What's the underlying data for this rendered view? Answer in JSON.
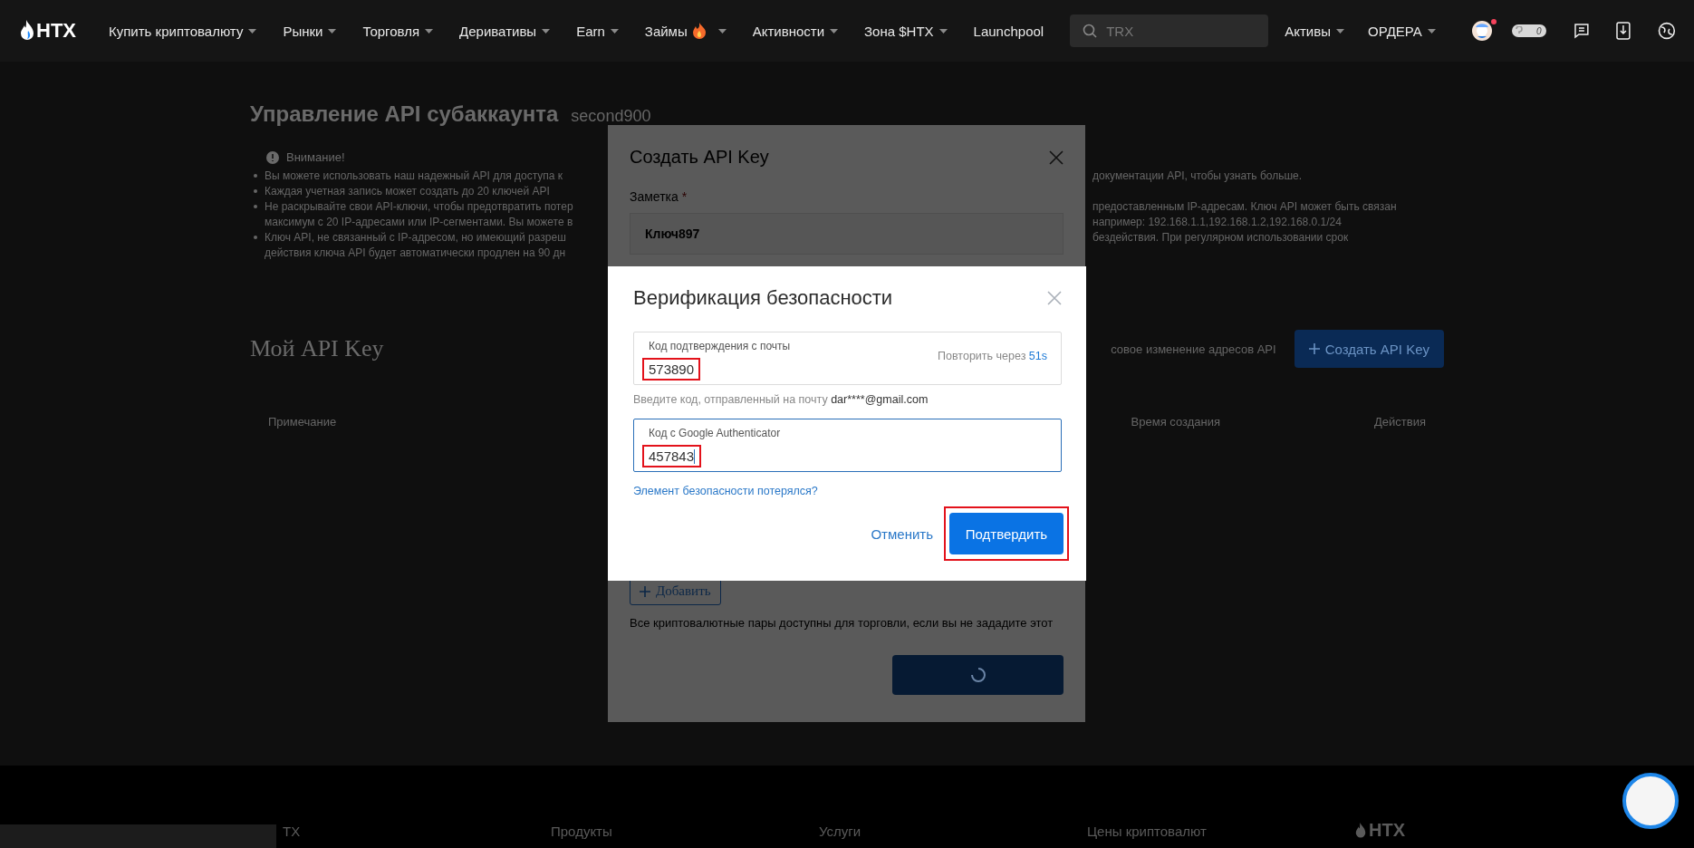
{
  "nav": {
    "logo": "HTX",
    "items": [
      {
        "label": "Купить криптовалюту",
        "dropdown": true,
        "hot": false
      },
      {
        "label": "Рынки",
        "dropdown": true,
        "hot": false
      },
      {
        "label": "Торговля",
        "dropdown": true,
        "hot": false
      },
      {
        "label": "Деривативы",
        "dropdown": true,
        "hot": false
      },
      {
        "label": "Earn",
        "dropdown": true,
        "hot": false
      },
      {
        "label": "Займы",
        "dropdown": true,
        "hot": true
      },
      {
        "label": "Активности",
        "dropdown": true,
        "hot": false
      },
      {
        "label": "Зона $HTX",
        "dropdown": true,
        "hot": false
      },
      {
        "label": "Launchpool",
        "dropdown": false,
        "hot": false
      }
    ],
    "search": {
      "placeholder": "TRX"
    },
    "right_items": [
      {
        "label": "Активы",
        "dropdown": true
      },
      {
        "label": "ОРДЕРА",
        "dropdown": true
      }
    ],
    "avatar_notification": true,
    "pill_text": "0"
  },
  "page": {
    "title": "Управление API субаккаунта",
    "subtitle": "second900",
    "notice_title": "Внимание!",
    "notice_rows": [
      {
        "left": "Вы можете использовать наш надежный API для доступа к",
        "right": "документации API, чтобы узнать больше.",
        "bullet": true
      },
      {
        "left": "Каждая учетная запись может создать до 20 ключей API",
        "bullet": true
      },
      {
        "left": "Не раскрывайте свои API-ключи, чтобы предотвратить потер",
        "right": "предоставленным IP-адресам. Ключ API может быть связан",
        "bullet": true
      },
      {
        "left": "максимум с 20 IP-адресами или IP-сегментами. Вы можете в",
        "right": "например: 192.168.1.1,192.168.1.2,192.168.0.1/24",
        "bullet": false
      },
      {
        "left": "Ключ API, не связанный с IP-адресом, но имеющий разреш",
        "right": "бездействия. При регулярном использовании срок",
        "bullet": true
      },
      {
        "left": "действия ключа API будет автоматически продлен на 90 дн",
        "bullet": false
      }
    ],
    "my_api_title": "Мой API Key",
    "bulk_link": "совое изменение адресов API",
    "create_button": "Создать API Key",
    "table": {
      "columns": [
        "Примечание",
        "Время создания",
        "Действия"
      ]
    }
  },
  "create_modal": {
    "title": "Создать API Key",
    "note_label": "Заметка",
    "required_mark": "*",
    "note_value": "Ключ897",
    "add_button": "Добавить",
    "hint": "Все криптовалютные пары доступны для торговли, если вы не зададите этот",
    "submit_loading": true
  },
  "verify_modal": {
    "title": "Верификация безопасности",
    "fields": [
      {
        "label": "Код подтверждения с почты",
        "value": "573890",
        "focused": false,
        "highlighted": true,
        "resend_text": "Повторить через",
        "countdown": "51s"
      },
      {
        "label": "Код с Google Authenticator",
        "value": "457843",
        "focused": true,
        "highlighted": true
      }
    ],
    "email_hint": "Введите код, отправленный на почту",
    "email": "dar****@gmail.com",
    "lost_link": "Элемент безопасности потерялся?",
    "cancel": "Отменить",
    "confirm": "Подтвердить",
    "confirm_highlighted": true
  },
  "footer": {
    "columns": [
      "TX",
      "Продукты",
      "Услуги",
      "Цены криптовалют"
    ],
    "logo": "HTX"
  }
}
